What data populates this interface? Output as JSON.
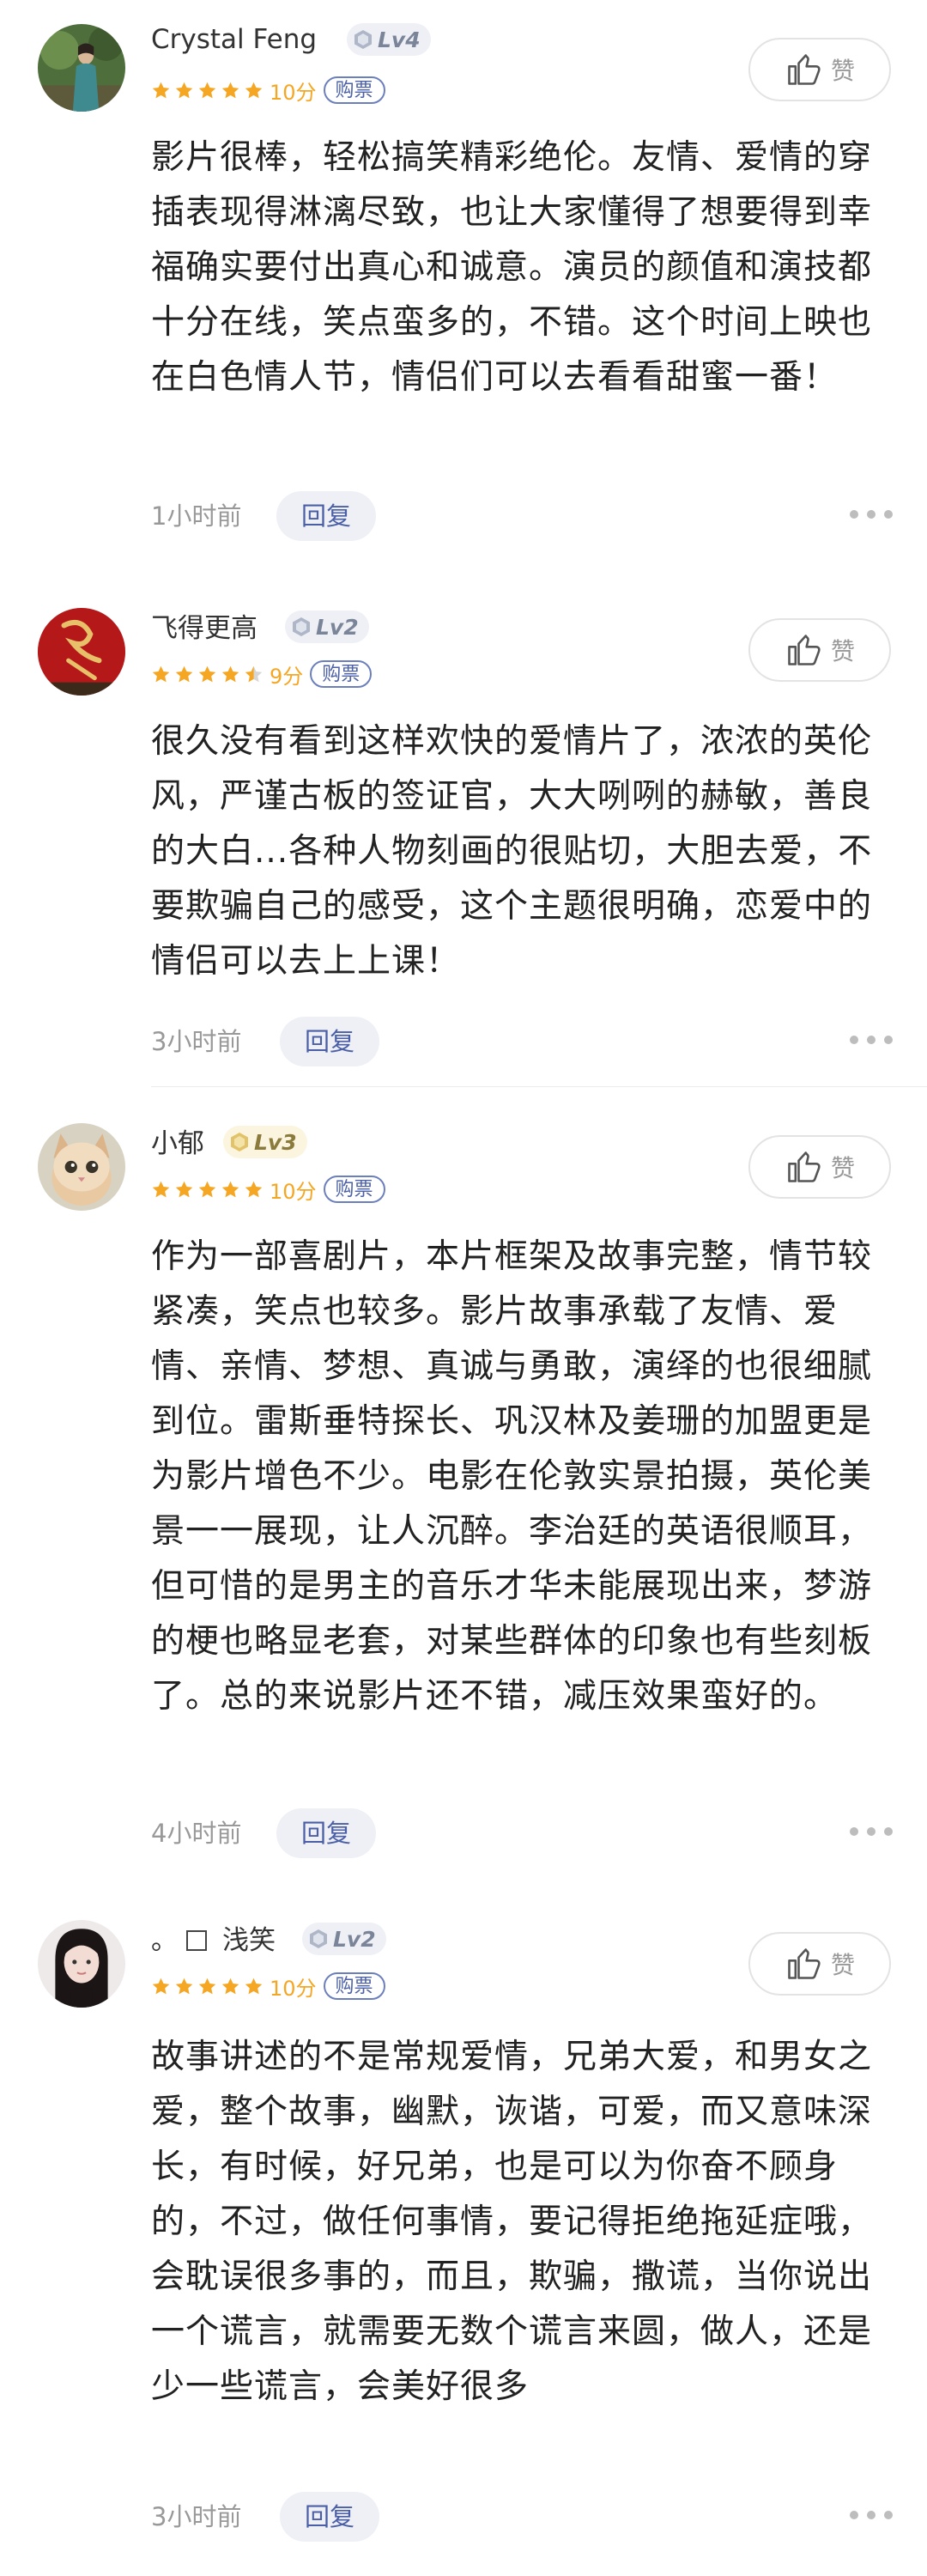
{
  "comments": [
    {
      "username": "Crystal Feng",
      "level": "Lv4",
      "stars": 5,
      "score": "10分",
      "ticket": "购票",
      "like": "赞",
      "text": "影片很棒，轻松搞笑精彩绝伦。友情、爱情的穿插表现得淋漓尽致，也让大家懂得了想要得到幸福确实要付出真心和诚意。演员的颜值和演技都十分在线，笑点蛮多的，不错。这个时间上映也在白色情人节，情侣们可以去看看甜蜜一番！",
      "time": "1小时前",
      "reply": "回复"
    },
    {
      "username": "飞得更高",
      "level": "Lv2",
      "stars": 4.5,
      "score": "9分",
      "ticket": "购票",
      "like": "赞",
      "text": "很久没有看到这样欢快的爱情片了，浓浓的英伦风，严谨古板的签证官，大大咧咧的赫敏，善良的大白...各种人物刻画的很贴切，大胆去爱，不要欺骗自己的感受，这个主题很明确，恋爱中的情侣可以去上上课！",
      "time": "3小时前",
      "reply": "回复"
    },
    {
      "username": "小郁",
      "level": "Lv3",
      "stars": 5,
      "score": "10分",
      "ticket": "购票",
      "like": "赞",
      "text": "作为一部喜剧片，本片框架及故事完整，情节较紧凑，笑点也较多。影片故事承载了友情、爱情、亲情、梦想、真诚与勇敢，演绎的也很细腻到位。雷斯垂特探长、巩汉林及姜珊的加盟更是为影片增色不少。电影在伦敦实景拍摄，英伦美景一一展现，让人沉醉。李治廷的英语很顺耳，但可惜的是男主的音乐才华未能展现出来，梦游的梗也略显老套，对某些群体的印象也有些刻板了。总的来说影片还不错，减压效果蛮好的。",
      "time": "4小时前",
      "reply": "回复"
    },
    {
      "username_prefix": "。",
      "username": "浅笑",
      "level": "Lv2",
      "stars": 5,
      "score": "10分",
      "ticket": "购票",
      "like": "赞",
      "text": "故事讲述的不是常规爱情，兄弟大爱，和男女之爱，整个故事，幽默，诙谐，可爱，而又意味深长，有时候，好兄弟，也是可以为你奋不顾身的，不过，做任何事情，要记得拒绝拖延症哦，会耽误很多事的，而且，欺骗，撒谎，当你说出一个谎言，就需要无数个谎言来圆，做人，还是少一些谎言，会美好很多",
      "time": "3小时前",
      "reply": "回复"
    }
  ]
}
